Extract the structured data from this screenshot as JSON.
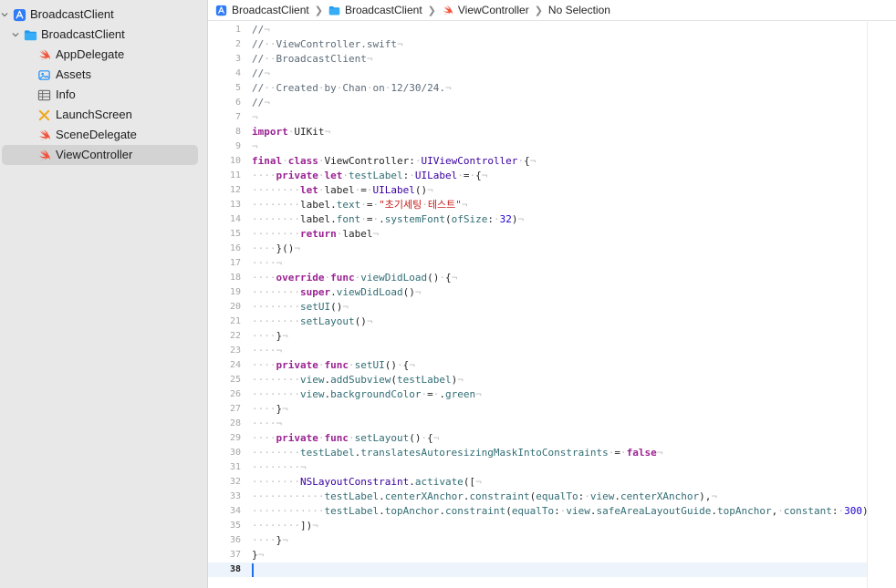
{
  "sidebar": {
    "items": [
      {
        "label": "BroadcastClient",
        "icon": "xcode-project-icon",
        "chevron": "chevron-down-icon",
        "depth": 0
      },
      {
        "label": "BroadcastClient",
        "icon": "folder-icon",
        "chevron": "chevron-down-icon",
        "depth": 1
      },
      {
        "label": "AppDelegate",
        "icon": "swift-file-icon",
        "depth": 2
      },
      {
        "label": "Assets",
        "icon": "asset-catalog-icon",
        "depth": 2
      },
      {
        "label": "Info",
        "icon": "plist-table-icon",
        "depth": 2
      },
      {
        "label": "LaunchScreen",
        "icon": "storyboard-icon",
        "depth": 2
      },
      {
        "label": "SceneDelegate",
        "icon": "swift-file-icon",
        "depth": 2
      },
      {
        "label": "ViewController",
        "icon": "swift-file-icon",
        "depth": 2,
        "selected": true
      }
    ]
  },
  "jumpbar": {
    "crumbs": [
      {
        "label": "BroadcastClient",
        "icon": "xcode-project-icon"
      },
      {
        "label": "BroadcastClient",
        "icon": "folder-icon"
      },
      {
        "label": "ViewController",
        "icon": "swift-file-icon"
      },
      {
        "label": "No Selection",
        "icon": ""
      }
    ]
  },
  "editor": {
    "current_line": 38,
    "lines": [
      [
        [
          "c",
          "//"
        ],
        [
          "i",
          "¬"
        ]
      ],
      [
        [
          "c",
          "//"
        ],
        [
          "i",
          "··"
        ],
        [
          "c",
          "ViewController.swift"
        ],
        [
          "i",
          "¬"
        ]
      ],
      [
        [
          "c",
          "//"
        ],
        [
          "i",
          "··"
        ],
        [
          "c",
          "BroadcastClient"
        ],
        [
          "i",
          "¬"
        ]
      ],
      [
        [
          "c",
          "//"
        ],
        [
          "i",
          "¬"
        ]
      ],
      [
        [
          "c",
          "//"
        ],
        [
          "i",
          "··"
        ],
        [
          "c",
          "Created"
        ],
        [
          "i",
          "·"
        ],
        [
          "c",
          "by"
        ],
        [
          "i",
          "·"
        ],
        [
          "c",
          "Chan"
        ],
        [
          "i",
          "·"
        ],
        [
          "c",
          "on"
        ],
        [
          "i",
          "·"
        ],
        [
          "c",
          "12/30/24."
        ],
        [
          "i",
          "¬"
        ]
      ],
      [
        [
          "c",
          "//"
        ],
        [
          "i",
          "¬"
        ]
      ],
      [
        [
          "i",
          "¬"
        ]
      ],
      [
        [
          "k",
          "import"
        ],
        [
          "i",
          "·"
        ],
        [
          "p",
          "UIKit"
        ],
        [
          "i",
          "¬"
        ]
      ],
      [
        [
          "i",
          "¬"
        ]
      ],
      [
        [
          "k",
          "final"
        ],
        [
          "i",
          "·"
        ],
        [
          "k",
          "class"
        ],
        [
          "i",
          "·"
        ],
        [
          "p",
          "ViewController:"
        ],
        [
          "i",
          "·"
        ],
        [
          "t",
          "UIViewController"
        ],
        [
          "i",
          "·"
        ],
        [
          "p",
          "{"
        ],
        [
          "i",
          "¬"
        ]
      ],
      [
        [
          "i",
          "····"
        ],
        [
          "k",
          "private"
        ],
        [
          "i",
          "·"
        ],
        [
          "k",
          "let"
        ],
        [
          "i",
          "·"
        ],
        [
          "pr",
          "testLabel"
        ],
        [
          "p",
          ":"
        ],
        [
          "i",
          "·"
        ],
        [
          "t",
          "UILabel"
        ],
        [
          "i",
          "·"
        ],
        [
          "p",
          "="
        ],
        [
          "i",
          "·"
        ],
        [
          "p",
          "{"
        ],
        [
          "i",
          "¬"
        ]
      ],
      [
        [
          "i",
          "········"
        ],
        [
          "k",
          "let"
        ],
        [
          "i",
          "·"
        ],
        [
          "p",
          "label"
        ],
        [
          "i",
          "·"
        ],
        [
          "p",
          "="
        ],
        [
          "i",
          "·"
        ],
        [
          "t",
          "UILabel"
        ],
        [
          "p",
          "()"
        ],
        [
          "i",
          "¬"
        ]
      ],
      [
        [
          "i",
          "········"
        ],
        [
          "p",
          "label."
        ],
        [
          "pr",
          "text"
        ],
        [
          "i",
          "·"
        ],
        [
          "p",
          "="
        ],
        [
          "i",
          "·"
        ],
        [
          "s",
          "\"초기세팅"
        ],
        [
          "i",
          "·"
        ],
        [
          "s",
          "테스트\""
        ],
        [
          "i",
          "¬"
        ]
      ],
      [
        [
          "i",
          "········"
        ],
        [
          "p",
          "label."
        ],
        [
          "pr",
          "font"
        ],
        [
          "i",
          "·"
        ],
        [
          "p",
          "="
        ],
        [
          "i",
          "·"
        ],
        [
          "p",
          "."
        ],
        [
          "pr",
          "systemFont"
        ],
        [
          "p",
          "("
        ],
        [
          "pr",
          "ofSize"
        ],
        [
          "p",
          ":"
        ],
        [
          "i",
          "·"
        ],
        [
          "n",
          "32"
        ],
        [
          "p",
          ")"
        ],
        [
          "i",
          "¬"
        ]
      ],
      [
        [
          "i",
          "········"
        ],
        [
          "k",
          "return"
        ],
        [
          "i",
          "·"
        ],
        [
          "p",
          "label"
        ],
        [
          "i",
          "¬"
        ]
      ],
      [
        [
          "i",
          "····"
        ],
        [
          "p",
          "}()"
        ],
        [
          "i",
          "¬"
        ]
      ],
      [
        [
          "i",
          "····¬"
        ]
      ],
      [
        [
          "i",
          "····"
        ],
        [
          "k",
          "override"
        ],
        [
          "i",
          "·"
        ],
        [
          "k",
          "func"
        ],
        [
          "i",
          "·"
        ],
        [
          "pr",
          "viewDidLoad"
        ],
        [
          "p",
          "()"
        ],
        [
          "i",
          "·"
        ],
        [
          "p",
          "{"
        ],
        [
          "i",
          "¬"
        ]
      ],
      [
        [
          "i",
          "········"
        ],
        [
          "k",
          "super"
        ],
        [
          "p",
          "."
        ],
        [
          "pr",
          "viewDidLoad"
        ],
        [
          "p",
          "()"
        ],
        [
          "i",
          "¬"
        ]
      ],
      [
        [
          "i",
          "········"
        ],
        [
          "pr",
          "setUI"
        ],
        [
          "p",
          "()"
        ],
        [
          "i",
          "¬"
        ]
      ],
      [
        [
          "i",
          "········"
        ],
        [
          "pr",
          "setLayout"
        ],
        [
          "p",
          "()"
        ],
        [
          "i",
          "¬"
        ]
      ],
      [
        [
          "i",
          "····"
        ],
        [
          "p",
          "}"
        ],
        [
          "i",
          "¬"
        ]
      ],
      [
        [
          "i",
          "····¬"
        ]
      ],
      [
        [
          "i",
          "····"
        ],
        [
          "k",
          "private"
        ],
        [
          "i",
          "·"
        ],
        [
          "k",
          "func"
        ],
        [
          "i",
          "·"
        ],
        [
          "pr",
          "setUI"
        ],
        [
          "p",
          "()"
        ],
        [
          "i",
          "·"
        ],
        [
          "p",
          "{"
        ],
        [
          "i",
          "¬"
        ]
      ],
      [
        [
          "i",
          "········"
        ],
        [
          "pr",
          "view"
        ],
        [
          "p",
          "."
        ],
        [
          "pr",
          "addSubview"
        ],
        [
          "p",
          "("
        ],
        [
          "pr",
          "testLabel"
        ],
        [
          "p",
          ")"
        ],
        [
          "i",
          "¬"
        ]
      ],
      [
        [
          "i",
          "········"
        ],
        [
          "pr",
          "view"
        ],
        [
          "p",
          "."
        ],
        [
          "pr",
          "backgroundColor"
        ],
        [
          "i",
          "·"
        ],
        [
          "p",
          "="
        ],
        [
          "i",
          "·"
        ],
        [
          "p",
          "."
        ],
        [
          "pr",
          "green"
        ],
        [
          "i",
          "¬"
        ]
      ],
      [
        [
          "i",
          "····"
        ],
        [
          "p",
          "}"
        ],
        [
          "i",
          "¬"
        ]
      ],
      [
        [
          "i",
          "····¬"
        ]
      ],
      [
        [
          "i",
          "····"
        ],
        [
          "k",
          "private"
        ],
        [
          "i",
          "·"
        ],
        [
          "k",
          "func"
        ],
        [
          "i",
          "·"
        ],
        [
          "pr",
          "setLayout"
        ],
        [
          "p",
          "()"
        ],
        [
          "i",
          "·"
        ],
        [
          "p",
          "{"
        ],
        [
          "i",
          "¬"
        ]
      ],
      [
        [
          "i",
          "········"
        ],
        [
          "pr",
          "testLabel"
        ],
        [
          "p",
          "."
        ],
        [
          "pr",
          "translatesAutoresizingMaskIntoConstraints"
        ],
        [
          "i",
          "·"
        ],
        [
          "p",
          "="
        ],
        [
          "i",
          "·"
        ],
        [
          "k",
          "false"
        ],
        [
          "i",
          "¬"
        ]
      ],
      [
        [
          "i",
          "········¬"
        ]
      ],
      [
        [
          "i",
          "········"
        ],
        [
          "t",
          "NSLayoutConstraint"
        ],
        [
          "p",
          "."
        ],
        [
          "pr",
          "activate"
        ],
        [
          "p",
          "(["
        ],
        [
          "i",
          "¬"
        ]
      ],
      [
        [
          "i",
          "············"
        ],
        [
          "pr",
          "testLabel"
        ],
        [
          "p",
          "."
        ],
        [
          "pr",
          "centerXAnchor"
        ],
        [
          "p",
          "."
        ],
        [
          "pr",
          "constraint"
        ],
        [
          "p",
          "("
        ],
        [
          "pr",
          "equalTo"
        ],
        [
          "p",
          ":"
        ],
        [
          "i",
          "·"
        ],
        [
          "pr",
          "view"
        ],
        [
          "p",
          "."
        ],
        [
          "pr",
          "centerXAnchor"
        ],
        [
          "p",
          "),"
        ],
        [
          "i",
          "¬"
        ]
      ],
      [
        [
          "i",
          "············"
        ],
        [
          "pr",
          "testLabel"
        ],
        [
          "p",
          "."
        ],
        [
          "pr",
          "topAnchor"
        ],
        [
          "p",
          "."
        ],
        [
          "pr",
          "constraint"
        ],
        [
          "p",
          "("
        ],
        [
          "pr",
          "equalTo"
        ],
        [
          "p",
          ":"
        ],
        [
          "i",
          "·"
        ],
        [
          "pr",
          "view"
        ],
        [
          "p",
          "."
        ],
        [
          "pr",
          "safeAreaLayoutGuide"
        ],
        [
          "p",
          "."
        ],
        [
          "pr",
          "topAnchor"
        ],
        [
          "p",
          ","
        ],
        [
          "i",
          "·"
        ],
        [
          "pr",
          "constant"
        ],
        [
          "p",
          ":"
        ],
        [
          "i",
          "·"
        ],
        [
          "n",
          "300"
        ],
        [
          "p",
          ")"
        ],
        [
          "i",
          "¬"
        ]
      ],
      [
        [
          "i",
          "········"
        ],
        [
          "p",
          "])"
        ],
        [
          "i",
          "¬"
        ]
      ],
      [
        [
          "i",
          "····"
        ],
        [
          "p",
          "}"
        ],
        [
          "i",
          "¬"
        ]
      ],
      [
        [
          "p",
          "}"
        ],
        [
          "i",
          "¬"
        ]
      ],
      []
    ]
  },
  "colors": {
    "sidebar_bg": "#e8e8e8",
    "selection_bg": "#d3d3d3",
    "keyword": "#9b2393",
    "type": "#3900a0",
    "property": "#326d74",
    "string": "#c41a16",
    "number": "#1c00cf",
    "comment": "#5d6c79",
    "invisible": "#bdbdbd",
    "caret": "#1e6ef0",
    "current_line_bg": "#eef4fb"
  }
}
